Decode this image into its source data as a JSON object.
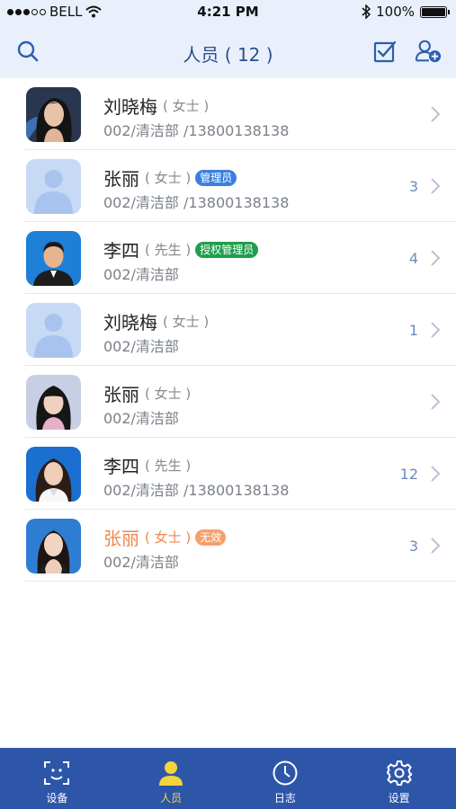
{
  "status_bar": {
    "carrier": "BELL",
    "time": "4:21 PM",
    "battery": "100%"
  },
  "header": {
    "title": "人员 ( 12 )"
  },
  "people": [
    {
      "name": "刘晓梅",
      "gender": "( 女士 )",
      "badge": "",
      "sub": "002/清洁部 /13800138138",
      "count": "",
      "avatar": "photo-woman-dark-hair"
    },
    {
      "name": "张丽",
      "gender": "( 女士 )",
      "badge": "管理员",
      "badge_color": "#3d7fe0",
      "sub": "002/清洁部 /13800138138",
      "count": "3",
      "avatar": "placeholder-person"
    },
    {
      "name": "李四",
      "gender": "( 先生 )",
      "badge": "授权管理员",
      "badge_color": "#1f9e4b",
      "sub": "002/清洁部",
      "count": "4",
      "avatar": "photo-man-blue-bg"
    },
    {
      "name": "刘晓梅",
      "gender": "( 女士 )",
      "badge": "",
      "sub": "002/清洁部",
      "count": "1",
      "avatar": "placeholder-person"
    },
    {
      "name": "张丽",
      "gender": "( 女士 )",
      "badge": "",
      "sub": "002/清洁部",
      "count": "",
      "avatar": "photo-girl-bangs"
    },
    {
      "name": "李四",
      "gender": "( 先生 )",
      "badge": "",
      "sub": "002/清洁部 /13800138138",
      "count": "12",
      "avatar": "photo-woman-white-shirt"
    },
    {
      "name": "张丽",
      "gender": "( 女士 )",
      "badge": "无效",
      "badge_color": "#f5a06c",
      "sub": "002/清洁部",
      "count": "3",
      "avatar": "photo-woman-blue-bg",
      "invalid": true
    }
  ],
  "tabs": [
    {
      "label": "设备",
      "icon": "face-scan-icon",
      "active": false
    },
    {
      "label": "人员",
      "icon": "person-icon",
      "active": true
    },
    {
      "label": "日志",
      "icon": "clock-icon",
      "active": false
    },
    {
      "label": "设置",
      "icon": "gear-icon",
      "active": false
    }
  ],
  "colors": {
    "header_bg": "#e9f0fb",
    "accent": "#2d56a9",
    "active_tab": "#f5d33a",
    "invalid_text": "#f0864a"
  }
}
